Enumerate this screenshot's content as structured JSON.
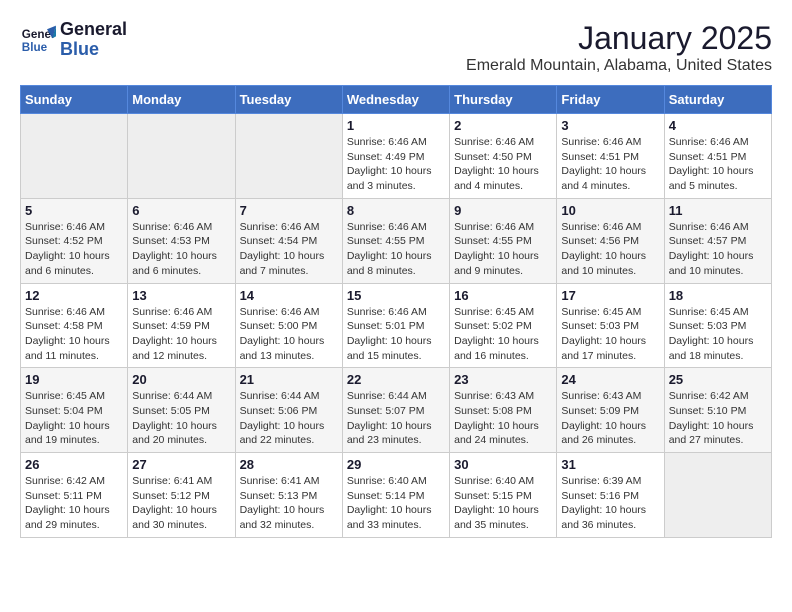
{
  "logo": {
    "text_general": "General",
    "text_blue": "Blue"
  },
  "header": {
    "title": "January 2025",
    "subtitle": "Emerald Mountain, Alabama, United States"
  },
  "weekdays": [
    "Sunday",
    "Monday",
    "Tuesday",
    "Wednesday",
    "Thursday",
    "Friday",
    "Saturday"
  ],
  "weeks": [
    [
      {
        "day": "",
        "info": ""
      },
      {
        "day": "",
        "info": ""
      },
      {
        "day": "",
        "info": ""
      },
      {
        "day": "1",
        "info": "Sunrise: 6:46 AM\nSunset: 4:49 PM\nDaylight: 10 hours and 3 minutes."
      },
      {
        "day": "2",
        "info": "Sunrise: 6:46 AM\nSunset: 4:50 PM\nDaylight: 10 hours and 4 minutes."
      },
      {
        "day": "3",
        "info": "Sunrise: 6:46 AM\nSunset: 4:51 PM\nDaylight: 10 hours and 4 minutes."
      },
      {
        "day": "4",
        "info": "Sunrise: 6:46 AM\nSunset: 4:51 PM\nDaylight: 10 hours and 5 minutes."
      }
    ],
    [
      {
        "day": "5",
        "info": "Sunrise: 6:46 AM\nSunset: 4:52 PM\nDaylight: 10 hours and 6 minutes."
      },
      {
        "day": "6",
        "info": "Sunrise: 6:46 AM\nSunset: 4:53 PM\nDaylight: 10 hours and 6 minutes."
      },
      {
        "day": "7",
        "info": "Sunrise: 6:46 AM\nSunset: 4:54 PM\nDaylight: 10 hours and 7 minutes."
      },
      {
        "day": "8",
        "info": "Sunrise: 6:46 AM\nSunset: 4:55 PM\nDaylight: 10 hours and 8 minutes."
      },
      {
        "day": "9",
        "info": "Sunrise: 6:46 AM\nSunset: 4:55 PM\nDaylight: 10 hours and 9 minutes."
      },
      {
        "day": "10",
        "info": "Sunrise: 6:46 AM\nSunset: 4:56 PM\nDaylight: 10 hours and 10 minutes."
      },
      {
        "day": "11",
        "info": "Sunrise: 6:46 AM\nSunset: 4:57 PM\nDaylight: 10 hours and 10 minutes."
      }
    ],
    [
      {
        "day": "12",
        "info": "Sunrise: 6:46 AM\nSunset: 4:58 PM\nDaylight: 10 hours and 11 minutes."
      },
      {
        "day": "13",
        "info": "Sunrise: 6:46 AM\nSunset: 4:59 PM\nDaylight: 10 hours and 12 minutes."
      },
      {
        "day": "14",
        "info": "Sunrise: 6:46 AM\nSunset: 5:00 PM\nDaylight: 10 hours and 13 minutes."
      },
      {
        "day": "15",
        "info": "Sunrise: 6:46 AM\nSunset: 5:01 PM\nDaylight: 10 hours and 15 minutes."
      },
      {
        "day": "16",
        "info": "Sunrise: 6:45 AM\nSunset: 5:02 PM\nDaylight: 10 hours and 16 minutes."
      },
      {
        "day": "17",
        "info": "Sunrise: 6:45 AM\nSunset: 5:03 PM\nDaylight: 10 hours and 17 minutes."
      },
      {
        "day": "18",
        "info": "Sunrise: 6:45 AM\nSunset: 5:03 PM\nDaylight: 10 hours and 18 minutes."
      }
    ],
    [
      {
        "day": "19",
        "info": "Sunrise: 6:45 AM\nSunset: 5:04 PM\nDaylight: 10 hours and 19 minutes."
      },
      {
        "day": "20",
        "info": "Sunrise: 6:44 AM\nSunset: 5:05 PM\nDaylight: 10 hours and 20 minutes."
      },
      {
        "day": "21",
        "info": "Sunrise: 6:44 AM\nSunset: 5:06 PM\nDaylight: 10 hours and 22 minutes."
      },
      {
        "day": "22",
        "info": "Sunrise: 6:44 AM\nSunset: 5:07 PM\nDaylight: 10 hours and 23 minutes."
      },
      {
        "day": "23",
        "info": "Sunrise: 6:43 AM\nSunset: 5:08 PM\nDaylight: 10 hours and 24 minutes."
      },
      {
        "day": "24",
        "info": "Sunrise: 6:43 AM\nSunset: 5:09 PM\nDaylight: 10 hours and 26 minutes."
      },
      {
        "day": "25",
        "info": "Sunrise: 6:42 AM\nSunset: 5:10 PM\nDaylight: 10 hours and 27 minutes."
      }
    ],
    [
      {
        "day": "26",
        "info": "Sunrise: 6:42 AM\nSunset: 5:11 PM\nDaylight: 10 hours and 29 minutes."
      },
      {
        "day": "27",
        "info": "Sunrise: 6:41 AM\nSunset: 5:12 PM\nDaylight: 10 hours and 30 minutes."
      },
      {
        "day": "28",
        "info": "Sunrise: 6:41 AM\nSunset: 5:13 PM\nDaylight: 10 hours and 32 minutes."
      },
      {
        "day": "29",
        "info": "Sunrise: 6:40 AM\nSunset: 5:14 PM\nDaylight: 10 hours and 33 minutes."
      },
      {
        "day": "30",
        "info": "Sunrise: 6:40 AM\nSunset: 5:15 PM\nDaylight: 10 hours and 35 minutes."
      },
      {
        "day": "31",
        "info": "Sunrise: 6:39 AM\nSunset: 5:16 PM\nDaylight: 10 hours and 36 minutes."
      },
      {
        "day": "",
        "info": ""
      }
    ]
  ]
}
